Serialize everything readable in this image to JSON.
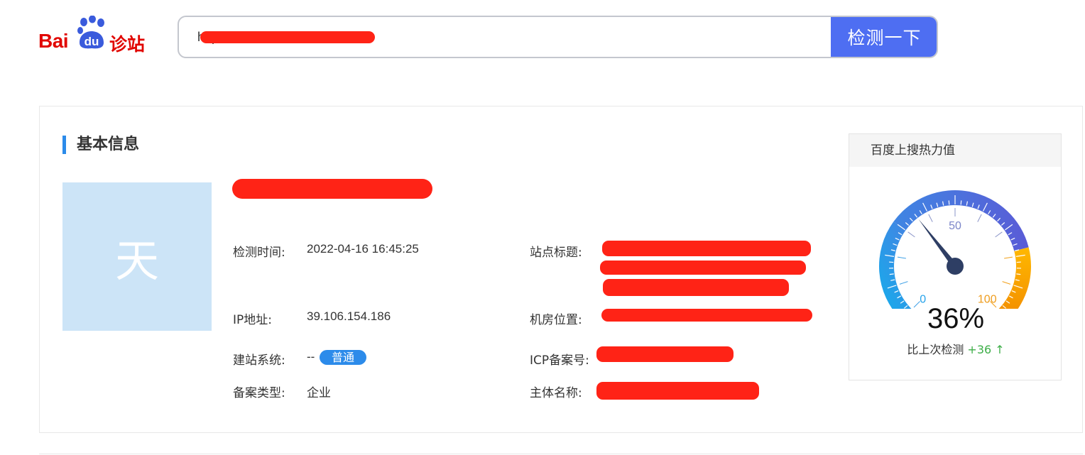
{
  "logo": {
    "bai": "Bai",
    "du": "du",
    "zhan": "诊站"
  },
  "search": {
    "url": "https://",
    "button": "检测一下"
  },
  "basic_info": {
    "title": "基本信息",
    "avatar_char": "天",
    "fields": {
      "check_time": {
        "label": "检测时间:",
        "value": "2022-04-16 16:45:25"
      },
      "site_title": {
        "label": "站点标题:"
      },
      "ip": {
        "label": "IP地址:",
        "value": "39.106.154.186"
      },
      "location": {
        "label": "机房位置:"
      },
      "cms": {
        "label": "建站系统:",
        "value": "--",
        "badge": "普通"
      },
      "icp": {
        "label": "ICP备案号:"
      },
      "record_type": {
        "label": "备案类型:",
        "value": "企业"
      },
      "owner": {
        "label": "主体名称:"
      }
    }
  },
  "heat": {
    "title": "百度上搜热力值",
    "percent": 36,
    "percent_text": "36%",
    "compare_label": "比上次检测",
    "delta": "+36 ↑",
    "scale_labels": [
      "0",
      "50",
      "100"
    ],
    "colors": {
      "low": "#1aa7ea",
      "high": "#5060d8",
      "warn": "#f7a600",
      "needle": "#2e3e64"
    }
  }
}
